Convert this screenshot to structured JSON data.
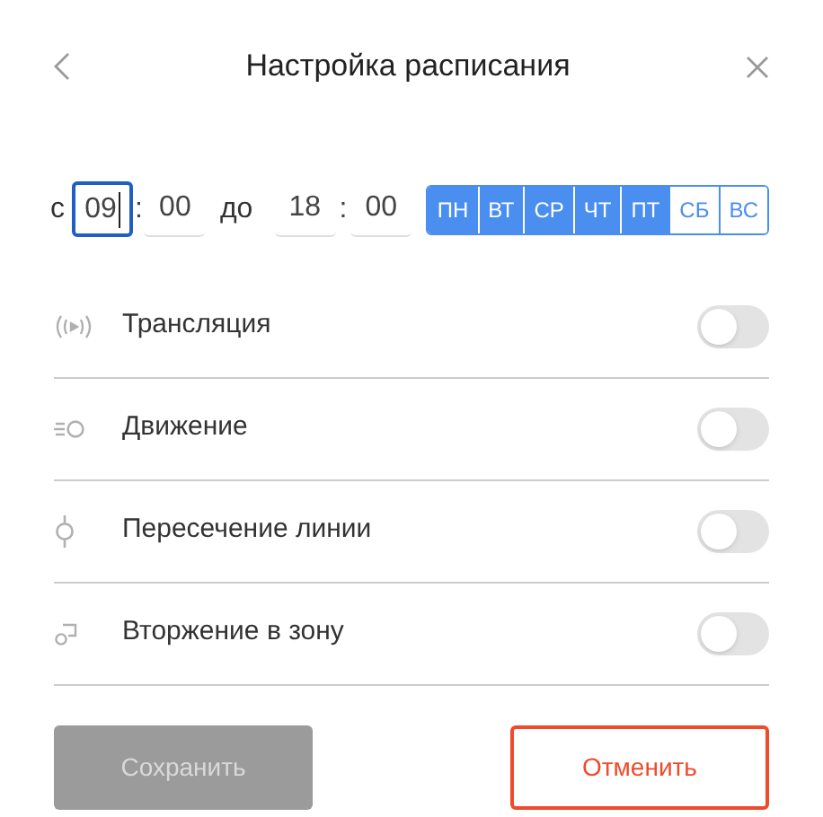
{
  "header": {
    "title": "Настройка расписания"
  },
  "time": {
    "from_label": "с",
    "from_hours": "09",
    "from_hours_focused": true,
    "from_separator": ":",
    "from_minutes": "00",
    "to_label": "до",
    "to_hours": "18",
    "to_separator": ":",
    "to_minutes": "00"
  },
  "days": [
    {
      "label": "ПН",
      "selected": true
    },
    {
      "label": "ВТ",
      "selected": true
    },
    {
      "label": "СР",
      "selected": true
    },
    {
      "label": "ЧТ",
      "selected": true
    },
    {
      "label": "ПТ",
      "selected": true
    },
    {
      "label": "СБ",
      "selected": false
    },
    {
      "label": "ВС",
      "selected": false
    }
  ],
  "settings": [
    {
      "kind": "broadcast",
      "label": "Трансляция",
      "on": false
    },
    {
      "kind": "motion",
      "label": "Движение",
      "on": false
    },
    {
      "kind": "line",
      "label": "Пересечение линии",
      "on": false
    },
    {
      "kind": "zone",
      "label": "Вторжение в зону",
      "on": false
    }
  ],
  "buttons": {
    "save": {
      "label": "Сохранить",
      "disabled": true
    },
    "cancel": {
      "label": "Отменить"
    }
  }
}
